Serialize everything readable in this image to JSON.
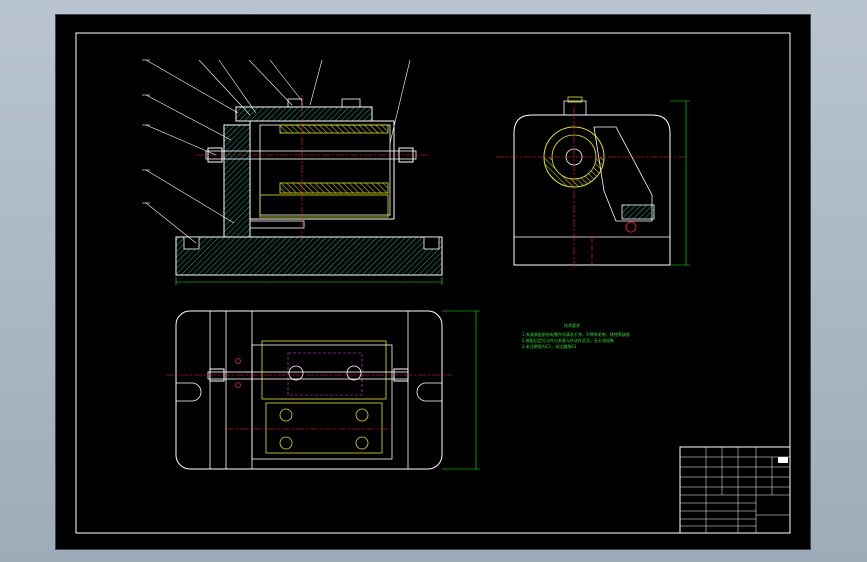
{
  "viewer": {
    "background": "#000000",
    "frame_color": "#ffffff"
  },
  "colors": {
    "outline": "#ffffff",
    "hatch_green": "#00b894",
    "hatch_yellow": "#e5e500",
    "centerline_red": "#ff2020",
    "magenta": "#ff33ff",
    "dimension_green": "#00ff00",
    "cyan": "#00e5ff",
    "note_green": "#2ee82e"
  },
  "icons": {
    "balloon_leaders": "leader-lines",
    "hatched_sections": "section-hatch"
  },
  "tech_notes": {
    "title": "技术要求",
    "lines": [
      "1.夹具装配前所有零件须清洗干净，不得有毛刺、锈蚀等缺陷",
      "2.装配后定位元件与夹紧元件动作灵活，无卡滞现象",
      "3.未注倒角为C1，未注圆角R1"
    ]
  },
  "title_block": {
    "rows": [
      "",
      "",
      "",
      "",
      "",
      ""
    ],
    "labels": [
      "",
      "",
      "",
      "",
      "",
      "",
      "",
      ""
    ]
  }
}
